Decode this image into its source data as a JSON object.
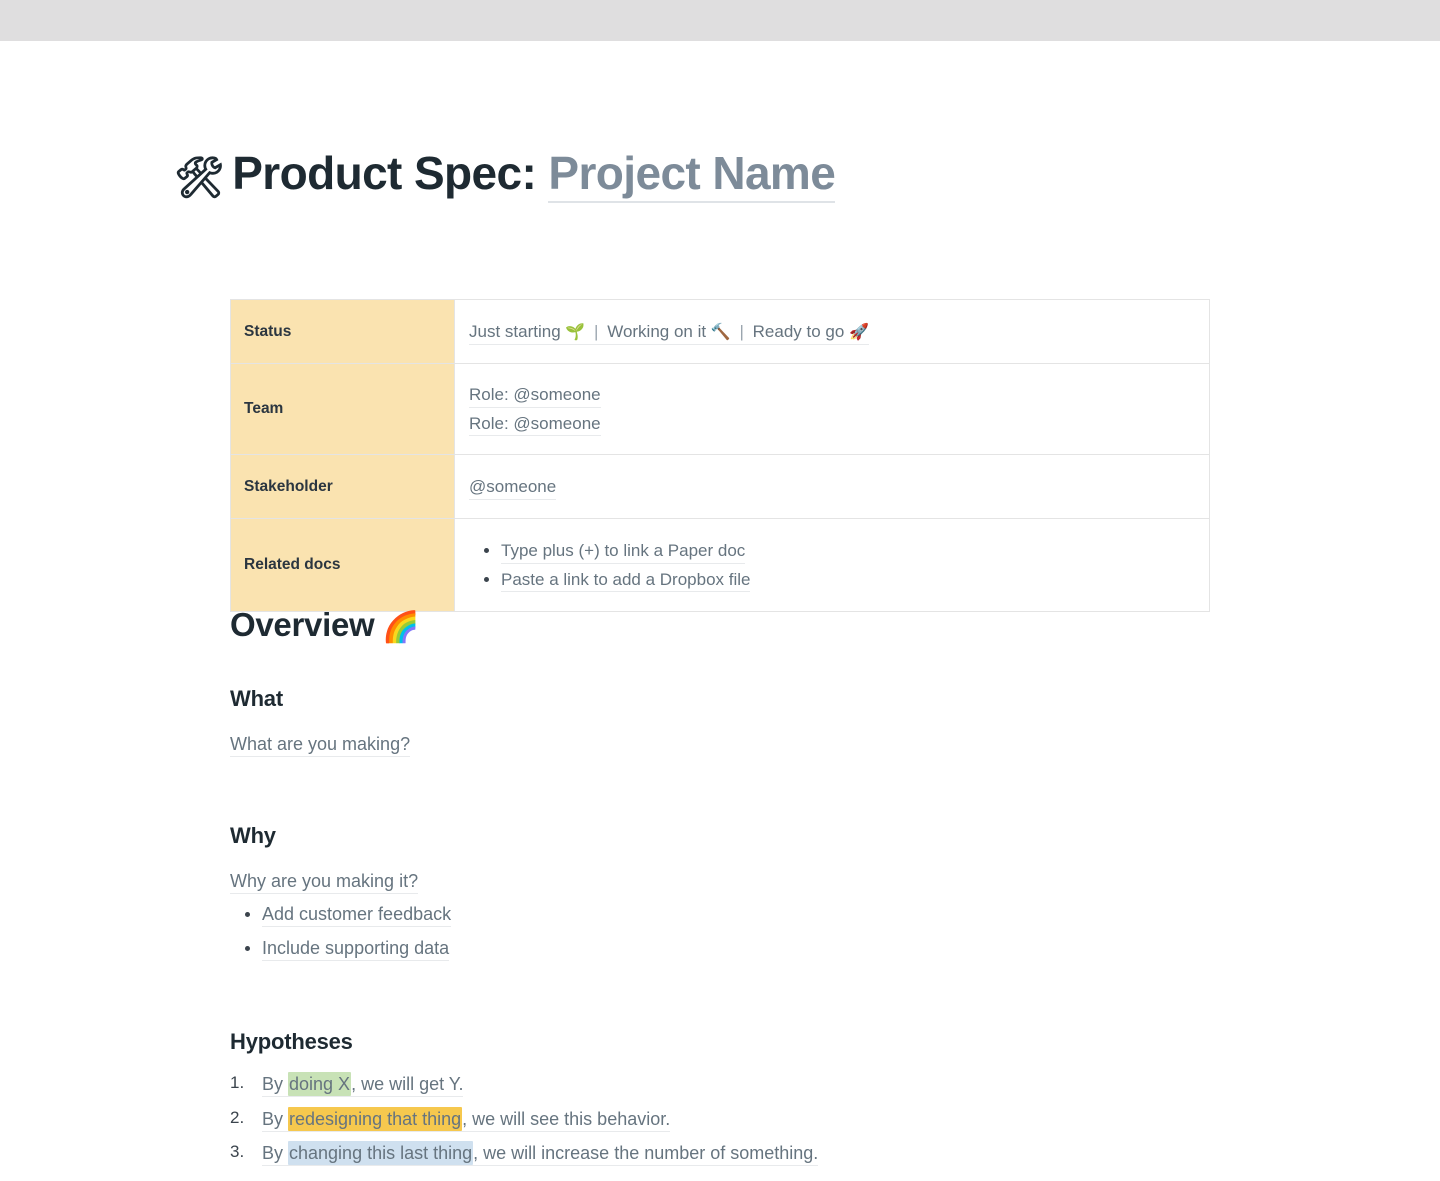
{
  "window": {
    "chrome_bar": true
  },
  "title": {
    "emoji": "🛠",
    "emoji_name": "hammer-and-wrench",
    "prefix": "Product Spec:",
    "placeholder": "Project Name"
  },
  "spec_table": {
    "rows": [
      {
        "key": "Status",
        "type": "status",
        "options": [
          {
            "label": "Just starting",
            "emoji": "🌱"
          },
          {
            "label": "Working on it",
            "emoji": "🔨"
          },
          {
            "label": "Ready to go",
            "emoji": "🚀"
          }
        ],
        "separator": "|"
      },
      {
        "key": "Team",
        "type": "lines",
        "lines": [
          "Role: @someone",
          "Role: @someone"
        ]
      },
      {
        "key": "Stakeholder",
        "type": "lines",
        "lines": [
          "@someone"
        ]
      },
      {
        "key": "Related docs",
        "type": "bullets",
        "bullets": [
          "Type plus (+) to link a Paper doc",
          "Paste a link to add a Dropbox file"
        ]
      }
    ]
  },
  "overview": {
    "heading": "Overview",
    "heading_emoji": "🌈",
    "heading_emoji_name": "rainbow",
    "what": {
      "heading": "What",
      "placeholder": "What are you making?"
    },
    "why": {
      "heading": "Why",
      "placeholder": "Why are you making it?",
      "bullets": [
        "Add customer feedback",
        "Include supporting data"
      ]
    },
    "hypotheses": {
      "heading": "Hypotheses",
      "items": [
        {
          "lead": "By ",
          "highlight": "doing X",
          "highlight_color": "#c8e2b6",
          "tail": ", we will get Y."
        },
        {
          "lead": "By ",
          "highlight": "redesigning that thing",
          "highlight_color": "#f6c84e",
          "tail": ", we will see this behavior."
        },
        {
          "lead": "By ",
          "highlight": "changing this last thing",
          "highlight_color": "#cfe0ef",
          "tail": ", we will increase the number of something."
        }
      ]
    }
  },
  "colors": {
    "chrome_bar": "#dfdedf",
    "table_key_bg": "#fae3b0",
    "placeholder_text": "#66747f",
    "heading_text": "#1e2a32",
    "border": "#e4e4e4"
  }
}
